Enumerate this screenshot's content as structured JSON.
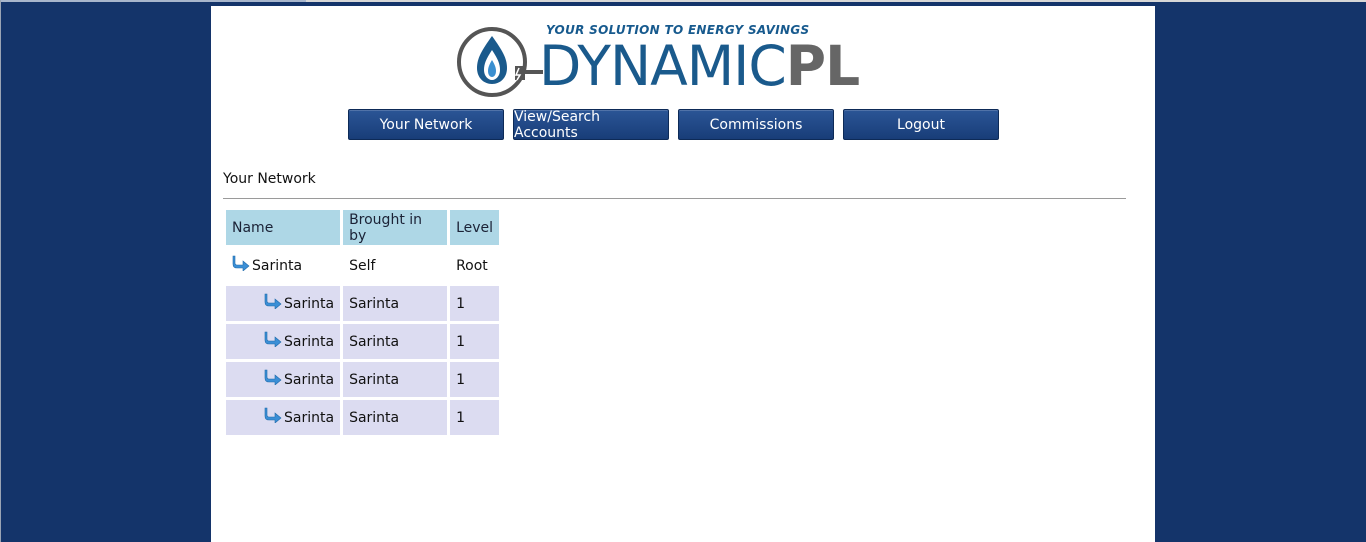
{
  "logo": {
    "tagline": "YOUR SOLUTION TO ENERGY SAVINGS",
    "word_main": "DYNAMIC",
    "word_accent": "PL",
    "icon": "flame-plug-icon"
  },
  "nav": {
    "items": [
      {
        "label": "Your Network"
      },
      {
        "label": "View/Search Accounts"
      },
      {
        "label": "Commissions"
      },
      {
        "label": "Logout"
      }
    ]
  },
  "section": {
    "title": "Your Network"
  },
  "table": {
    "headers": [
      "Name",
      "Brought in by",
      "Level"
    ],
    "rows": [
      {
        "name": "Sarinta",
        "brought_in_by": "Self",
        "level": "Root",
        "icon": "arrow-turn-icon"
      },
      {
        "name": "Sarinta",
        "brought_in_by": "Sarinta",
        "level": "1",
        "icon": "arrow-turn-icon"
      },
      {
        "name": "Sarinta",
        "brought_in_by": "Sarinta",
        "level": "1",
        "icon": "arrow-turn-icon"
      },
      {
        "name": "Sarinta",
        "brought_in_by": "Sarinta",
        "level": "1",
        "icon": "arrow-turn-icon"
      },
      {
        "name": "Sarinta",
        "brought_in_by": "Sarinta",
        "level": "1",
        "icon": "arrow-turn-icon"
      }
    ]
  },
  "colors": {
    "background": "#14346a",
    "button": "#1f4888",
    "header_cell": "#aed7e6",
    "alt_row": "#dcdcf1"
  }
}
